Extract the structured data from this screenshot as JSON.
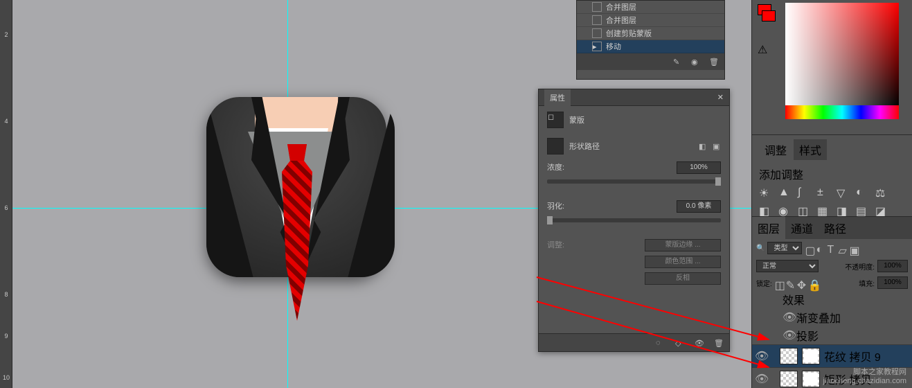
{
  "ruler": {
    "ticks": [
      "2",
      "4",
      "6",
      "8",
      "9",
      "10"
    ]
  },
  "history": {
    "items": [
      {
        "label": "合并图层"
      },
      {
        "label": "合并图层"
      },
      {
        "label": "创建剪贴蒙版"
      },
      {
        "label": "移动",
        "selected": true
      }
    ]
  },
  "properties": {
    "title": "属性",
    "mask_label": "蒙版",
    "shape_path": "形状路径",
    "density_label": "浓度:",
    "density_value": "100%",
    "feather_label": "羽化:",
    "feather_value": "0.0 像素",
    "adjust_label": "调整:",
    "mask_edge": "蒙版边缘 ...",
    "color_range": "颜色范围 ...",
    "invert": "反相"
  },
  "adjustments": {
    "tab1": "调整",
    "tab2": "样式",
    "add_label": "添加调整"
  },
  "layers": {
    "tab_layers": "图层",
    "tab_channels": "通道",
    "tab_paths": "路径",
    "filter_label": "类型",
    "blend_mode": "正常",
    "opacity_label": "不透明度:",
    "opacity_value": "100%",
    "lock_label": "锁定:",
    "fill_label": "填充:",
    "fill_value": "100%",
    "fx_header": "效果",
    "fx_gradient": "渐变叠加",
    "fx_shadow": "投影",
    "items": [
      {
        "name": "花纹 拷贝 9",
        "selected": true
      },
      {
        "name": "矩形 拷贝"
      }
    ]
  },
  "watermark": {
    "line1": "脚本之家教程网",
    "line2": "jiaocheng.chazidian.com"
  }
}
